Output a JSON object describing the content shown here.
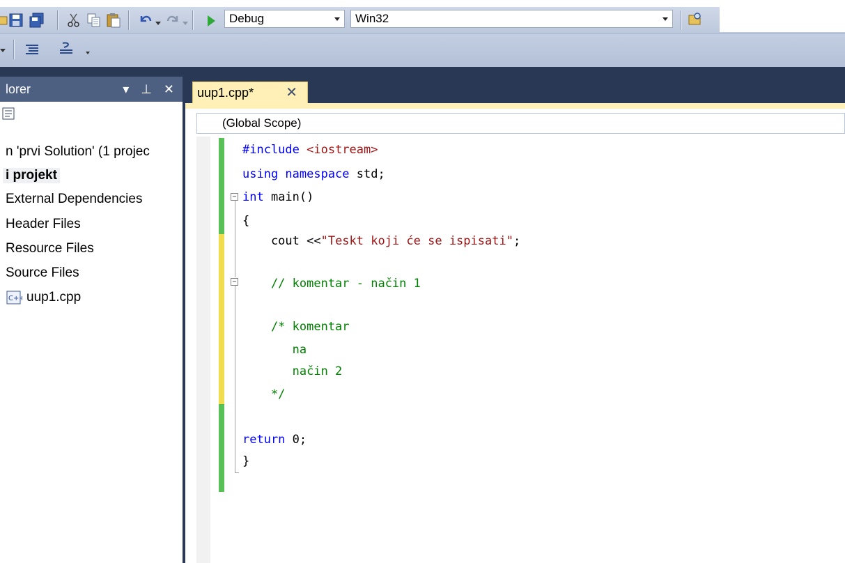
{
  "toolbar": {
    "config_combo": "Debug",
    "platform_combo": "Win32"
  },
  "solution_explorer": {
    "title": "lorer",
    "pin_buttons": "▾ ⊥ ✕",
    "items": [
      {
        "label": "n 'prvi Solution' (1 projec"
      },
      {
        "label": "i projekt"
      },
      {
        "label": "External Dependencies"
      },
      {
        "label": "Header Files"
      },
      {
        "label": "Resource Files"
      },
      {
        "label": "Source Files"
      },
      {
        "label": "uup1.cpp"
      }
    ]
  },
  "editor": {
    "tab_label": "uup1.cpp*",
    "tab_close": "✕",
    "scope": "(Global Scope)",
    "code": {
      "l1_pp": "#include",
      "l1_inc": " <iostream>",
      "l2_kw": "using namespace",
      "l2_rest": " std;",
      "l3_kw": "int",
      "l3_rest": " main()",
      "l4": "{",
      "l5_a": "    cout <<",
      "l5_str": "\"Teskt koji će se ispisati\"",
      "l5_b": ";",
      "l7": "    // komentar - način 1",
      "l9": "    /* komentar",
      "l10": "       na",
      "l11": "       način 2",
      "l12": "    */",
      "l14_kw": "return",
      "l14_rest": " 0;",
      "l15": "}"
    }
  },
  "colors": {
    "toolbar_bg": "#cfd8e8",
    "main_bg": "#293955",
    "tab_active": "#fff0b8",
    "change_saved": "#57c158",
    "change_unsaved": "#f0dc4e"
  }
}
